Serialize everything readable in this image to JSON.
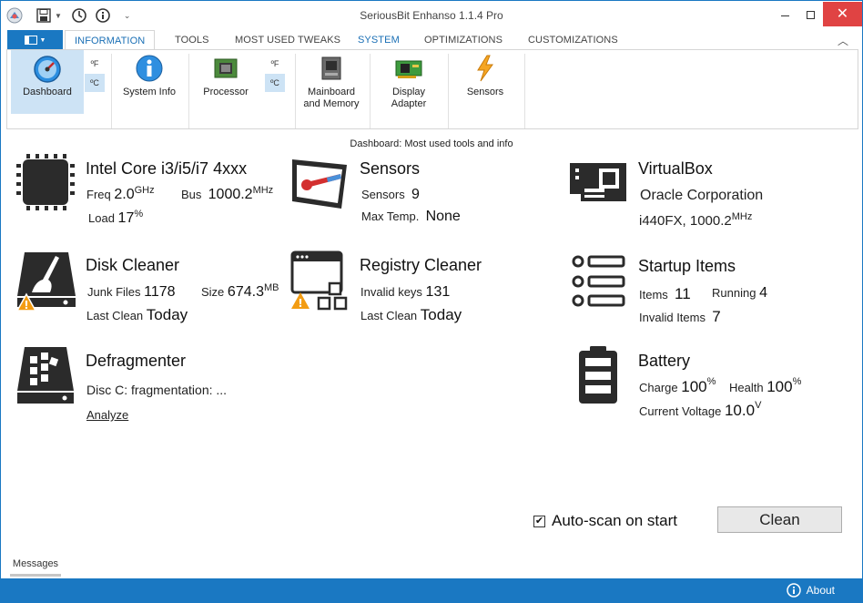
{
  "app": {
    "title": "SeriousBit Enhanso 1.1.4 Pro"
  },
  "tabs": [
    "INFORMATION",
    "TOOLS",
    "MOST USED TWEAKS",
    "SYSTEM",
    "OPTIMIZATIONS",
    "CUSTOMIZATIONS"
  ],
  "ribbon": {
    "dashboard": "Dashboard",
    "fahrenheit": "ºF",
    "celsius": "ºC",
    "system_info": "System Info",
    "processor": "Processor",
    "fahrenheit2": "ºF",
    "celsius2": "ºC",
    "mainboard_l1": "Mainboard",
    "mainboard_l2": "and Memory",
    "display_l1": "Display",
    "display_l2": "Adapter",
    "sensors": "Sensors"
  },
  "subtitle": "Dashboard: Most used tools and info",
  "cpu": {
    "title": "Intel Core i3/i5/i7 4xxx",
    "freq_label": "Freq",
    "freq_value": "2.0",
    "freq_unit": "GHz",
    "bus_label": "Bus",
    "bus_value": "1000.2",
    "bus_unit": "MHz",
    "load_label": "Load",
    "load_value": "17",
    "load_unit": "%"
  },
  "sensors": {
    "title": "Sensors",
    "count_label": "Sensors",
    "count_value": "9",
    "maxtemp_label": "Max Temp.",
    "maxtemp_value": "None"
  },
  "virtualbox": {
    "title": "VirtualBox",
    "vendor": "Oracle Corporation",
    "chipset": "i440FX, 1000.2",
    "chipset_unit": "MHz"
  },
  "disk": {
    "title": "Disk Cleaner",
    "junk_label": "Junk Files",
    "junk_value": "1178",
    "size_label": "Size",
    "size_value": "674.3",
    "size_unit": "MB",
    "last_label": "Last Clean",
    "last_value": "Today"
  },
  "registry": {
    "title": "Registry Cleaner",
    "invalid_label": "Invalid keys",
    "invalid_value": "131",
    "last_label": "Last Clean",
    "last_value": "Today"
  },
  "startup": {
    "title": "Startup Items",
    "items_label": "Items",
    "items_value": "11",
    "running_label": "Running",
    "running_value": "4",
    "invalid_label": "Invalid Items",
    "invalid_value": "7"
  },
  "defrag": {
    "title": "Defragmenter",
    "status": "Disc C: fragmentation: ...",
    "analyze": "Analyze"
  },
  "battery": {
    "title": "Battery",
    "charge_label": "Charge",
    "charge_value": "100",
    "charge_unit": "%",
    "health_label": "Health",
    "health_value": "100",
    "health_unit": "%",
    "voltage_label": "Current Voltage",
    "voltage_value": "10.0",
    "voltage_unit": "V"
  },
  "footer": {
    "autoscan": "Auto-scan on start",
    "autoscan_checked": true,
    "clean": "Clean",
    "messages": "Messages",
    "about": "About"
  },
  "colors": {
    "accent": "#1a78c2",
    "selection": "#cde3f5",
    "close": "#e04343"
  }
}
